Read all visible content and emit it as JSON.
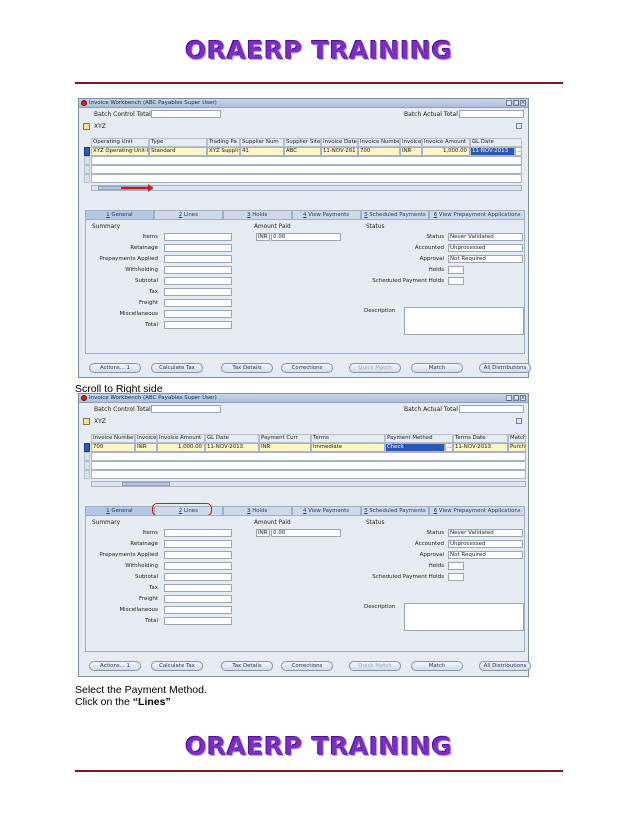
{
  "brand": "ORAERP TRAINING",
  "captions": {
    "scroll": "Scroll to Right side",
    "select": "Select the Payment Method.",
    "click_prefix": "Click on the ",
    "click_bold": "“Lines”"
  },
  "window": {
    "title": "Invoice Workbench (ABC Payables Super User)",
    "batch_control_total": "Batch Control Total",
    "batch_actual_total": "Batch Actual Total",
    "folder_name": "XYZ"
  },
  "grid1": {
    "headers": [
      "Operating Unit",
      "Type",
      "Trading Pa",
      "Supplier Num",
      "Supplier Site",
      "Invoice Date",
      "Invoice Numbe",
      "Invoice",
      "Invoice Amount",
      "GL Date"
    ],
    "row": [
      "XYZ Operating Unit-I",
      "Standard",
      "XYZ Suppli",
      "41",
      "ABC",
      "11-NOV-201",
      "700",
      "INR",
      "1,000.00",
      "11-NOV-2013"
    ]
  },
  "grid2": {
    "headers": [
      "Invoice Numbe",
      "Invoice",
      "Invoice Amount",
      "GL Date",
      "Payment Curr",
      "Terms",
      "Payment Method",
      "Terms Date",
      "Match"
    ],
    "row": [
      "700",
      "INR",
      "1,000.00",
      "11-NOV-2013",
      "INR",
      "Immediate",
      "Check",
      "11-NOV-2013",
      "Purcha"
    ]
  },
  "tabs": [
    {
      "key": "1",
      "label": " General"
    },
    {
      "key": "2",
      "label": " Lines"
    },
    {
      "key": "3",
      "label": " Holds"
    },
    {
      "key": "4",
      "label": " View Payments"
    },
    {
      "key": "5",
      "label": " Scheduled Payments"
    },
    {
      "key": "6",
      "label": " View Prepayment Applications"
    }
  ],
  "summary": {
    "title": "Summary",
    "labels": [
      "Items",
      "Retainage",
      "Prepayments Applied",
      "Withholding",
      "Subtotal",
      "Tax",
      "Freight",
      "Miscellaneous",
      "Total"
    ]
  },
  "amount_paid": {
    "title": "Amount Paid",
    "currency": "INR",
    "value": "0.00"
  },
  "status": {
    "title": "Status",
    "status_label": "Status",
    "status_value": "Never Validated",
    "accounted_label": "Accounted",
    "accounted_value": "Unprocessed",
    "approval_label": "Approval",
    "approval_value": "Not Required",
    "holds_label": "Holds",
    "sched_label": "Scheduled Payment Holds",
    "description_label": "Description"
  },
  "buttons": [
    "Actions... 1",
    "Calculate Tax",
    "Tax Details",
    "Corrections",
    "Quick Match",
    "Match",
    "All Distributions"
  ]
}
